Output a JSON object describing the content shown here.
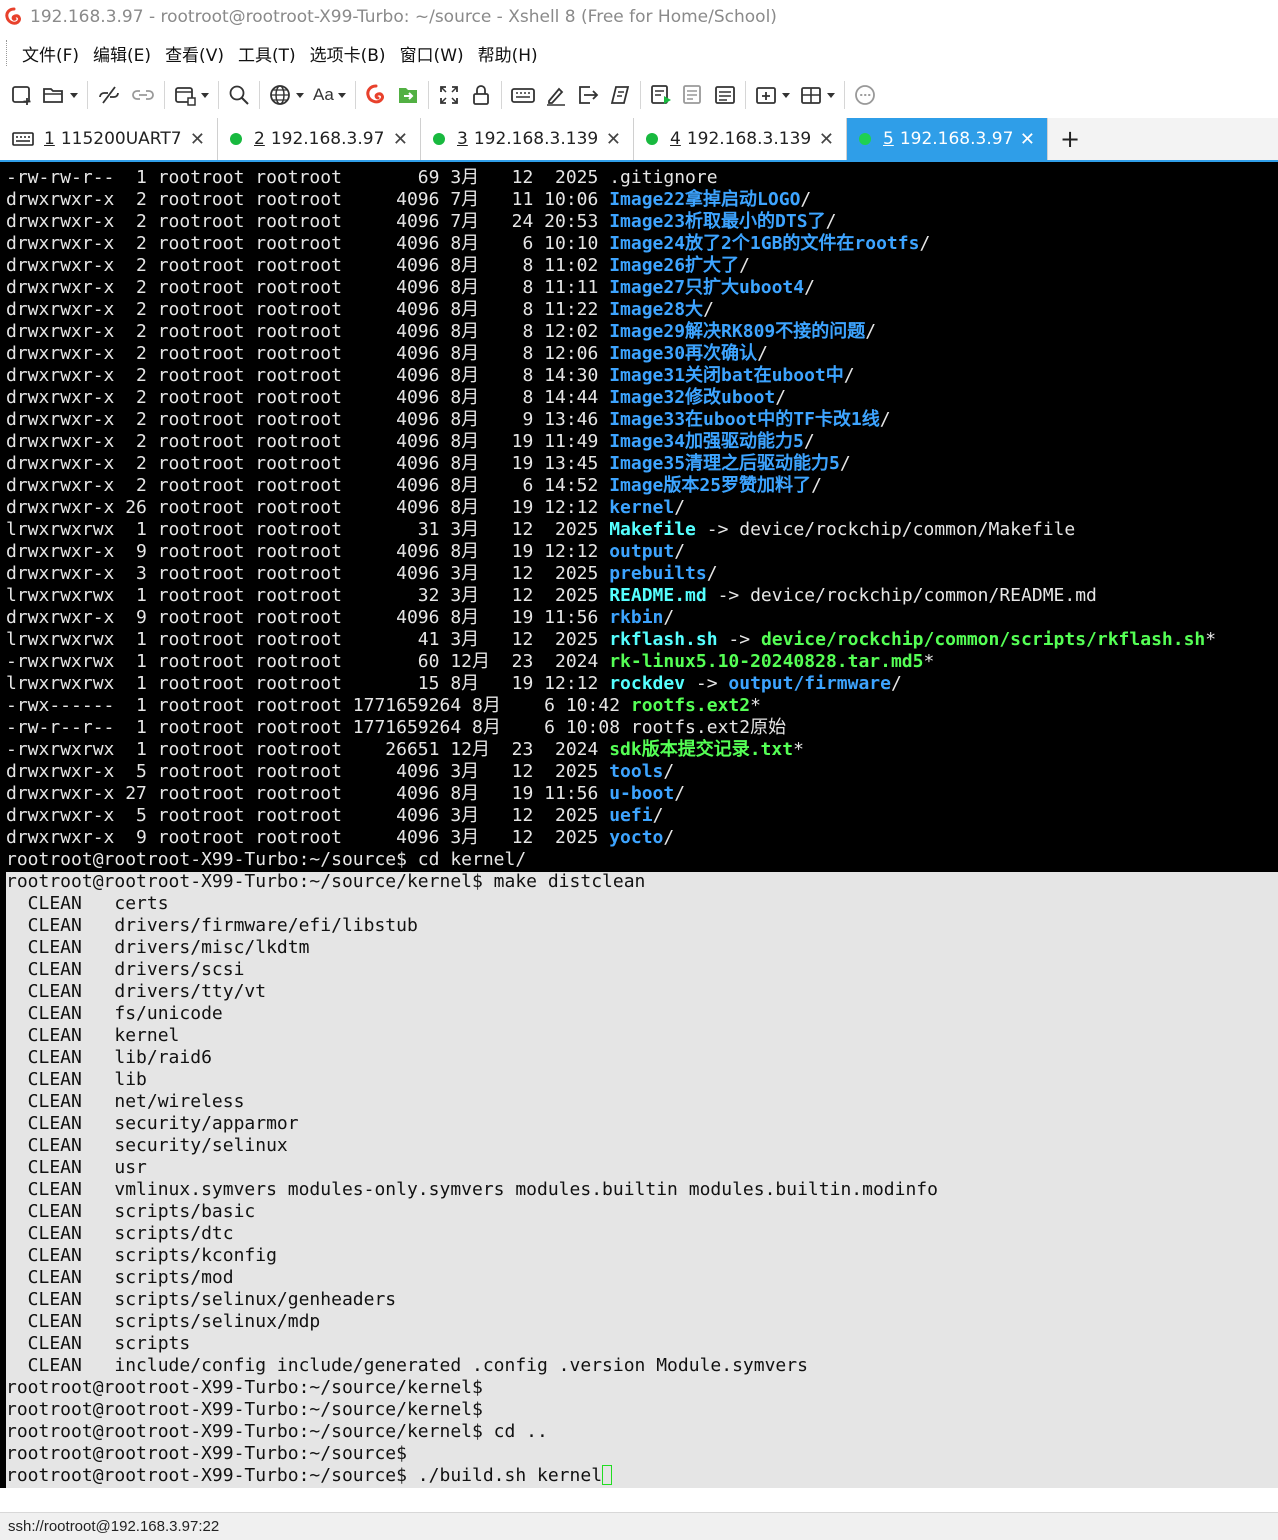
{
  "window": {
    "title": "192.168.3.97 - rootroot@rootroot-X99-Turbo: ~/source - Xshell 8 (Free for Home/School)",
    "accent": "#2f9ee8"
  },
  "menu": [
    "文件(F)",
    "编辑(E)",
    "查看(V)",
    "工具(T)",
    "选项卡(B)",
    "窗口(W)",
    "帮助(H)"
  ],
  "toolbar": {
    "font_button_label": "Aa",
    "icons": [
      "new-session-icon",
      "open-folder-icon",
      "disconnect-icon",
      "reconnect-icon",
      "new-window-icon",
      "search-icon",
      "globe-icon",
      "font-icon",
      "xshell-icon",
      "xftp-icon",
      "fullscreen-icon",
      "lock-icon",
      "keyboard-icon",
      "highlight-icon",
      "send-icon",
      "script-icon",
      "log-icon",
      "compose-icon",
      "compose-list-icon",
      "add-tab-icon",
      "layout-icon",
      "chat-icon"
    ]
  },
  "tabs": [
    {
      "num": "1",
      "label": "115200UART7",
      "type": "serial",
      "active": false
    },
    {
      "num": "2",
      "label": "192.168.3.97",
      "type": "ssh",
      "active": false
    },
    {
      "num": "3",
      "label": "192.168.3.139",
      "type": "ssh",
      "active": false
    },
    {
      "num": "4",
      "label": "192.168.3.139",
      "type": "ssh",
      "active": false
    },
    {
      "num": "5",
      "label": "192.168.3.97",
      "type": "ssh",
      "active": true
    }
  ],
  "tab_add_label": "+",
  "terminal": {
    "colors": {
      "background": "#000000",
      "text": "#e6e6e6",
      "directory": "#3da4ff",
      "executable": "#55ff55",
      "symlink": "#55ffff",
      "selection": "#e5e5e5"
    },
    "lines": [
      {
        "text": "-rw-rw-r--  1 rootroot rootroot       69 3月   12  2025 ",
        "name": ".gitignore",
        "kind": "file"
      },
      {
        "text": "drwxrwxr-x  2 rootroot rootroot     4096 7月   11 10:06 ",
        "name": "Image22拿掉启动LOGO",
        "kind": "dir",
        "suffix": "/"
      },
      {
        "text": "drwxrwxr-x  2 rootroot rootroot     4096 7月   24 20:53 ",
        "name": "Image23析取最小的DTS了",
        "kind": "dir",
        "suffix": "/"
      },
      {
        "text": "drwxrwxr-x  2 rootroot rootroot     4096 8月    6 10:10 ",
        "name": "Image24放了2个1GB的文件在rootfs",
        "kind": "dir",
        "suffix": "/"
      },
      {
        "text": "drwxrwxr-x  2 rootroot rootroot     4096 8月    8 11:02 ",
        "name": "Image26扩大了",
        "kind": "dir",
        "suffix": "/"
      },
      {
        "text": "drwxrwxr-x  2 rootroot rootroot     4096 8月    8 11:11 ",
        "name": "Image27只扩大uboot4",
        "kind": "dir",
        "suffix": "/"
      },
      {
        "text": "drwxrwxr-x  2 rootroot rootroot     4096 8月    8 11:22 ",
        "name": "Image28大",
        "kind": "dir",
        "suffix": "/"
      },
      {
        "text": "drwxrwxr-x  2 rootroot rootroot     4096 8月    8 12:02 ",
        "name": "Image29解决RK809不接的问题",
        "kind": "dir",
        "suffix": "/"
      },
      {
        "text": "drwxrwxr-x  2 rootroot rootroot     4096 8月    8 12:06 ",
        "name": "Image30再次确认",
        "kind": "dir",
        "suffix": "/"
      },
      {
        "text": "drwxrwxr-x  2 rootroot rootroot     4096 8月    8 14:30 ",
        "name": "Image31关闭bat在uboot中",
        "kind": "dir",
        "suffix": "/"
      },
      {
        "text": "drwxrwxr-x  2 rootroot rootroot     4096 8月    8 14:44 ",
        "name": "Image32修改uboot",
        "kind": "dir",
        "suffix": "/"
      },
      {
        "text": "drwxrwxr-x  2 rootroot rootroot     4096 8月    9 13:46 ",
        "name": "Image33在uboot中的TF卡改1线",
        "kind": "dir",
        "suffix": "/"
      },
      {
        "text": "drwxrwxr-x  2 rootroot rootroot     4096 8月   19 11:49 ",
        "name": "Image34加强驱动能力5",
        "kind": "dir",
        "suffix": "/"
      },
      {
        "text": "drwxrwxr-x  2 rootroot rootroot     4096 8月   19 13:45 ",
        "name": "Image35清理之后驱动能力5",
        "kind": "dir",
        "suffix": "/"
      },
      {
        "text": "drwxrwxr-x  2 rootroot rootroot     4096 8月    6 14:52 ",
        "name": "Image版本25罗赞加料了",
        "kind": "dir",
        "suffix": "/"
      },
      {
        "text": "drwxrwxr-x 26 rootroot rootroot     4096 8月   19 12:12 ",
        "name": "kernel",
        "kind": "dir",
        "suffix": "/"
      },
      {
        "text": "lrwxrwxrwx  1 rootroot rootroot       31 3月   12  2025 ",
        "name": "Makefile",
        "kind": "link",
        "suffix": " -> device/rockchip/common/Makefile"
      },
      {
        "text": "drwxrwxr-x  9 rootroot rootroot     4096 8月   19 12:12 ",
        "name": "output",
        "kind": "dir",
        "suffix": "/"
      },
      {
        "text": "drwxrwxr-x  3 rootroot rootroot     4096 3月   12  2025 ",
        "name": "prebuilts",
        "kind": "dir",
        "suffix": "/"
      },
      {
        "text": "lrwxrwxrwx  1 rootroot rootroot       32 3月   12  2025 ",
        "name": "README.md",
        "kind": "link",
        "suffix": " -> device/rockchip/common/README.md"
      },
      {
        "text": "drwxrwxr-x  9 rootroot rootroot     4096 8月   19 11:56 ",
        "name": "rkbin",
        "kind": "dir",
        "suffix": "/"
      },
      {
        "text": "lrwxrwxrwx  1 rootroot rootroot       41 3月   12  2025 ",
        "name": "rkflash.sh",
        "kind": "link",
        "arrow": " -> ",
        "target": "device/rockchip/common/scripts/rkflash.sh",
        "target_kind": "exe",
        "suffix": "*"
      },
      {
        "text": "-rwxrwxrwx  1 rootroot rootroot       60 12月  23  2024 ",
        "name": "rk-linux5.10-20240828.tar.md5",
        "kind": "exe",
        "suffix": "*"
      },
      {
        "text": "lrwxrwxrwx  1 rootroot rootroot       15 8月   19 12:12 ",
        "name": "rockdev",
        "kind": "link",
        "arrow": " -> ",
        "target": "output/firmware",
        "target_kind": "dir",
        "suffix": "/"
      },
      {
        "text": "-rwx------  1 rootroot rootroot 1771659264 8月    6 10:42 ",
        "name": "rootfs.ext2",
        "kind": "exe",
        "suffix": "*"
      },
      {
        "text": "-rw-r--r--  1 rootroot rootroot 1771659264 8月    6 10:08 ",
        "name": "rootfs.ext2原始",
        "kind": "file"
      },
      {
        "text": "-rwxrwxrwx  1 rootroot rootroot    26651 12月  23  2024 ",
        "name": "sdk版本提交记录.txt",
        "kind": "exe",
        "suffix": "*"
      },
      {
        "text": "drwxrwxr-x  5 rootroot rootroot     4096 3月   12  2025 ",
        "name": "tools",
        "kind": "dir",
        "suffix": "/"
      },
      {
        "text": "drwxrwxr-x 27 rootroot rootroot     4096 8月   19 11:56 ",
        "name": "u-boot",
        "kind": "dir",
        "suffix": "/"
      },
      {
        "text": "drwxrwxr-x  5 rootroot rootroot     4096 3月   12  2025 ",
        "name": "uefi",
        "kind": "dir",
        "suffix": "/"
      },
      {
        "text": "drwxrwxr-x  9 rootroot rootroot     4096 3月   12  2025 ",
        "name": "yocto",
        "kind": "dir",
        "suffix": "/"
      },
      {
        "text": "rootroot@rootroot-X99-Turbo:~/source$ cd kernel/",
        "kind": "plain"
      },
      {
        "text": "rootroot@rootroot-X99-Turbo:~/source/kernel$ make distclean",
        "kind": "sel"
      },
      {
        "text": "  CLEAN   certs",
        "kind": "sel"
      },
      {
        "text": "  CLEAN   drivers/firmware/efi/libstub",
        "kind": "sel"
      },
      {
        "text": "  CLEAN   drivers/misc/lkdtm",
        "kind": "sel"
      },
      {
        "text": "  CLEAN   drivers/scsi",
        "kind": "sel"
      },
      {
        "text": "  CLEAN   drivers/tty/vt",
        "kind": "sel"
      },
      {
        "text": "  CLEAN   fs/unicode",
        "kind": "sel"
      },
      {
        "text": "  CLEAN   kernel",
        "kind": "sel"
      },
      {
        "text": "  CLEAN   lib/raid6",
        "kind": "sel"
      },
      {
        "text": "  CLEAN   lib",
        "kind": "sel"
      },
      {
        "text": "  CLEAN   net/wireless",
        "kind": "sel"
      },
      {
        "text": "  CLEAN   security/apparmor",
        "kind": "sel"
      },
      {
        "text": "  CLEAN   security/selinux",
        "kind": "sel"
      },
      {
        "text": "  CLEAN   usr",
        "kind": "sel"
      },
      {
        "text": "  CLEAN   vmlinux.symvers modules-only.symvers modules.builtin modules.builtin.modinfo",
        "kind": "sel"
      },
      {
        "text": "  CLEAN   scripts/basic",
        "kind": "sel"
      },
      {
        "text": "  CLEAN   scripts/dtc",
        "kind": "sel"
      },
      {
        "text": "  CLEAN   scripts/kconfig",
        "kind": "sel"
      },
      {
        "text": "  CLEAN   scripts/mod",
        "kind": "sel"
      },
      {
        "text": "  CLEAN   scripts/selinux/genheaders",
        "kind": "sel"
      },
      {
        "text": "  CLEAN   scripts/selinux/mdp",
        "kind": "sel"
      },
      {
        "text": "  CLEAN   scripts",
        "kind": "sel"
      },
      {
        "text": "  CLEAN   include/config include/generated .config .version Module.symvers",
        "kind": "sel"
      },
      {
        "text": "rootroot@rootroot-X99-Turbo:~/source/kernel$",
        "kind": "sel"
      },
      {
        "text": "rootroot@rootroot-X99-Turbo:~/source/kernel$",
        "kind": "sel"
      },
      {
        "text": "rootroot@rootroot-X99-Turbo:~/source/kernel$ cd ..",
        "kind": "sel"
      },
      {
        "text": "rootroot@rootroot-X99-Turbo:~/source$",
        "kind": "sel"
      },
      {
        "text": "rootroot@rootroot-X99-Turbo:~/source$ ./build.sh kernel",
        "kind": "sel",
        "cursor": true
      }
    ]
  },
  "status": {
    "connection": "ssh://rootroot@192.168.3.97:22"
  }
}
